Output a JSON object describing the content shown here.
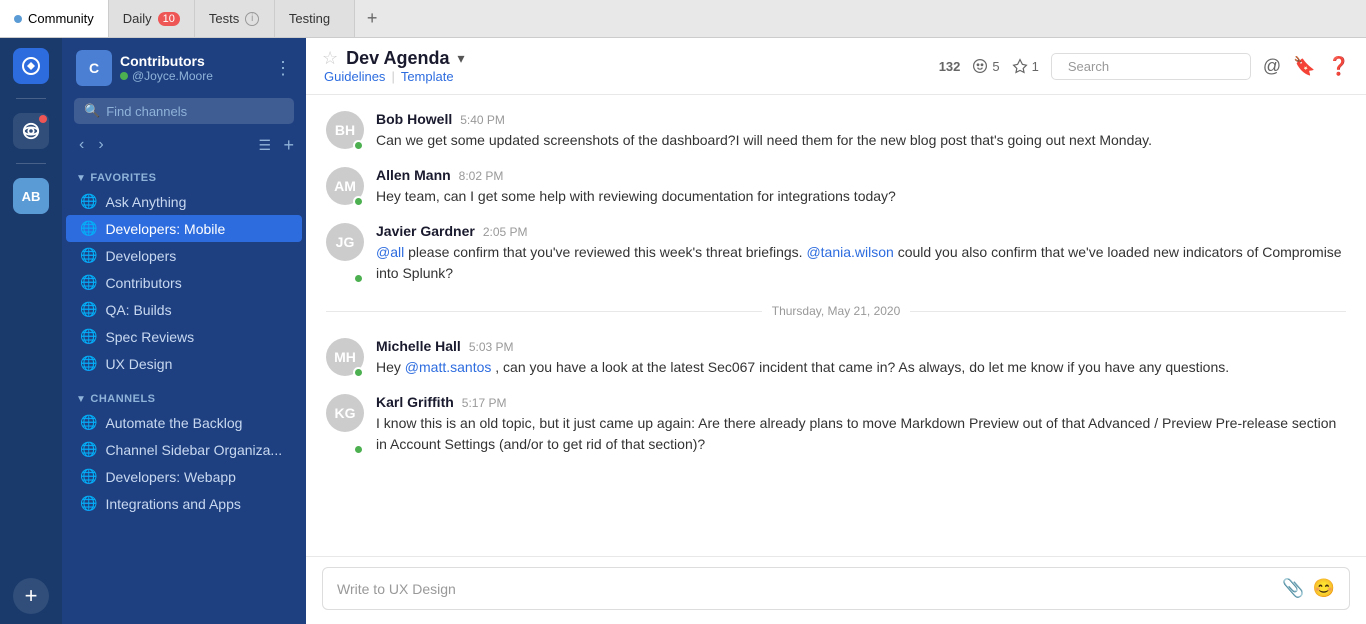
{
  "tabs": [
    {
      "id": "community",
      "label": "Community",
      "active": true,
      "dot": true,
      "badge": null
    },
    {
      "id": "daily",
      "label": "Daily",
      "active": false,
      "dot": false,
      "badge": "10"
    },
    {
      "id": "tests",
      "label": "Tests",
      "active": false,
      "dot": false,
      "info": true
    },
    {
      "id": "testing",
      "label": "Testing",
      "active": false,
      "dot": false
    },
    {
      "id": "add",
      "label": "+",
      "active": false
    }
  ],
  "icon_sidebar": {
    "ab_label": "AB"
  },
  "channel_sidebar": {
    "workspace_name": "Contributors",
    "username": "@Joyce.Moore",
    "find_placeholder": "Find channels",
    "favorites": {
      "header": "FAVORITES",
      "items": [
        {
          "icon": "⊕",
          "label": "Ask Anything",
          "active": false
        },
        {
          "icon": "⊕",
          "label": "Developers: Mobile",
          "active": true
        },
        {
          "icon": "⊕",
          "label": "Developers",
          "active": false
        },
        {
          "icon": "⊕",
          "label": "Contributors",
          "active": false
        },
        {
          "icon": "⊕",
          "label": "QA: Builds",
          "active": false
        },
        {
          "icon": "⊕",
          "label": "Spec Reviews",
          "active": false
        },
        {
          "icon": "⊕",
          "label": "UX Design",
          "active": false
        }
      ]
    },
    "channels": {
      "header": "CHANNELS",
      "items": [
        {
          "icon": "⊕",
          "label": "Automate the Backlog"
        },
        {
          "icon": "⊕",
          "label": "Channel Sidebar Organiza..."
        },
        {
          "icon": "⊕",
          "label": "Developers: Webapp"
        },
        {
          "icon": "⊕",
          "label": "Integrations and Apps"
        }
      ]
    }
  },
  "channel_header": {
    "name": "Dev Agenda",
    "links": {
      "guidelines": "Guidelines",
      "separator": "|",
      "template": "Template"
    },
    "stats": {
      "count": "132",
      "reactions": "5",
      "pins": "1"
    },
    "search_placeholder": "Search"
  },
  "messages": [
    {
      "id": "msg1",
      "author": "Bob Howell",
      "time": "5:40 PM",
      "avatar_initials": "BH",
      "avatar_class": "av-blue",
      "online": true,
      "text": "Can we get some updated screenshots of the dashboard?I will need them for the new blog post that's going out next Monday.",
      "mentions": []
    },
    {
      "id": "msg2",
      "author": "Allen Mann",
      "time": "8:02 PM",
      "avatar_initials": "AM",
      "avatar_class": "av-teal",
      "online": true,
      "text": "Hey team, can I get some help with reviewing documentation for integrations today?",
      "mentions": []
    },
    {
      "id": "msg3",
      "author": "Javier Gardner",
      "time": "2:05 PM",
      "avatar_initials": "JG",
      "avatar_class": "av-orange",
      "online": true,
      "text_parts": [
        {
          "type": "mention",
          "text": "@all"
        },
        {
          "type": "plain",
          "text": " please confirm that you've reviewed this week's threat briefings. "
        },
        {
          "type": "mention",
          "text": "@tania.wilson"
        },
        {
          "type": "plain",
          "text": " could you also confirm that we've loaded new indicators of Compromise into Splunk?"
        }
      ]
    }
  ],
  "date_divider": "Thursday, May 21, 2020",
  "messages2": [
    {
      "id": "msg4",
      "author": "Michelle Hall",
      "time": "5:03 PM",
      "avatar_initials": "MH",
      "avatar_class": "av-purple",
      "online": true,
      "text_parts": [
        {
          "type": "plain",
          "text": "Hey "
        },
        {
          "type": "mention",
          "text": "@matt.santos"
        },
        {
          "type": "plain",
          "text": ", can you have a look at the latest Sec067 incident that came in? As always, do let me know if you have any questions."
        }
      ]
    },
    {
      "id": "msg5",
      "author": "Karl Griffith",
      "time": "5:17 PM",
      "avatar_initials": "KG",
      "avatar_class": "av-green",
      "online": true,
      "text": "I know this is an old topic, but it just came up again: Are there already plans to move Markdown Preview out of that Advanced / Preview Pre-release section in Account Settings (and/or to get rid of that section)?",
      "mentions": []
    }
  ],
  "message_input": {
    "placeholder": "Write to UX Design"
  }
}
